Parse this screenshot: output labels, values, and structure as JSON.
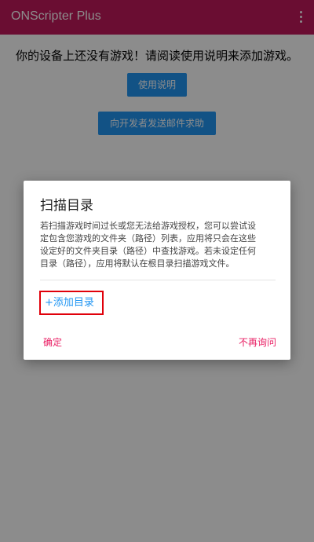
{
  "appbar": {
    "title": "ONScripter Plus",
    "overflow_icon": "more-vert-icon"
  },
  "main": {
    "empty_message": "你的设备上还没有游戏！请阅读使用说明来添加游戏。",
    "help_button_label": "使用说明",
    "email_button_label": "向开发者发送邮件求助"
  },
  "dialog": {
    "title": "扫描目录",
    "body_lines": [
      "若扫描游戏时间过长或您无法给游戏授权，您可以尝试设",
      "定包含您游戏的文件夹（路径）列表，应用将只会在这些",
      "设定好的文件夹目录（路径）中查找游戏。若未设定任何",
      "目录（路径），应用将默认在根目录扫描游戏文件。"
    ],
    "add_directory_label": "+添加目录",
    "confirm_label": "确定",
    "dont_ask_label": "不再询问"
  },
  "colors": {
    "appbar": "#c2185b",
    "primary_button": "#2196f3",
    "accent": "#e91e63",
    "highlight_border": "#e0000a"
  }
}
